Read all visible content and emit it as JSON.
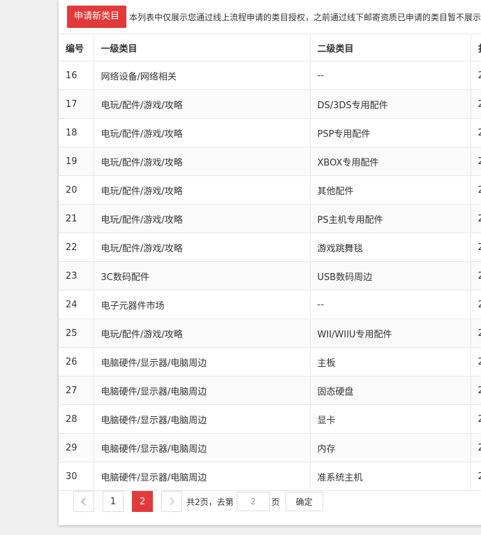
{
  "toolbar": {
    "apply_label": "申请新类目",
    "notice": "本列表中仅展示您通过线上流程申请的类目授权，之前通过线下邮寄资质已申请的类目暂不展示，"
  },
  "table": {
    "headers": [
      "编号",
      "一级类目",
      "二级类目",
      "扌"
    ],
    "rows": [
      {
        "id": "16",
        "cat1": "网络设备/网络相关",
        "cat2": "--",
        "extra": "2"
      },
      {
        "id": "17",
        "cat1": "电玩/配件/游戏/攻略",
        "cat2": "DS/3DS专用配件",
        "extra": "2"
      },
      {
        "id": "18",
        "cat1": "电玩/配件/游戏/攻略",
        "cat2": "PSP专用配件",
        "extra": "2"
      },
      {
        "id": "19",
        "cat1": "电玩/配件/游戏/攻略",
        "cat2": "XBOX专用配件",
        "extra": "2"
      },
      {
        "id": "20",
        "cat1": "电玩/配件/游戏/攻略",
        "cat2": "其他配件",
        "extra": "2"
      },
      {
        "id": "21",
        "cat1": "电玩/配件/游戏/攻略",
        "cat2": "PS主机专用配件",
        "extra": "2"
      },
      {
        "id": "22",
        "cat1": "电玩/配件/游戏/攻略",
        "cat2": "游戏跳舞毯",
        "extra": "2"
      },
      {
        "id": "23",
        "cat1": "3C数码配件",
        "cat2": "USB数码周边",
        "extra": "2"
      },
      {
        "id": "24",
        "cat1": "电子元器件市场",
        "cat2": "--",
        "extra": "2"
      },
      {
        "id": "25",
        "cat1": "电玩/配件/游戏/攻略",
        "cat2": "WII/WIIU专用配件",
        "extra": "2"
      },
      {
        "id": "26",
        "cat1": "电脑硬件/显示器/电脑周边",
        "cat2": "主板",
        "extra": "2"
      },
      {
        "id": "27",
        "cat1": "电脑硬件/显示器/电脑周边",
        "cat2": "固态硬盘",
        "extra": "2"
      },
      {
        "id": "28",
        "cat1": "电脑硬件/显示器/电脑周边",
        "cat2": "显卡",
        "extra": "2"
      },
      {
        "id": "29",
        "cat1": "电脑硬件/显示器/电脑周边",
        "cat2": "内存",
        "extra": "2"
      },
      {
        "id": "30",
        "cat1": "电脑硬件/显示器/电脑周边",
        "cat2": "准系统主机",
        "extra": "2"
      }
    ]
  },
  "pagination": {
    "pages": [
      "1",
      "2"
    ],
    "current_page": "2",
    "total_text": "共2页，去第",
    "input_value": "2",
    "page_suffix": "页",
    "confirm_label": "确定",
    "prev_icon": "chevron-left-icon",
    "next_icon": "chevron-right-icon"
  },
  "colors": {
    "accent": "#e23a3a"
  }
}
